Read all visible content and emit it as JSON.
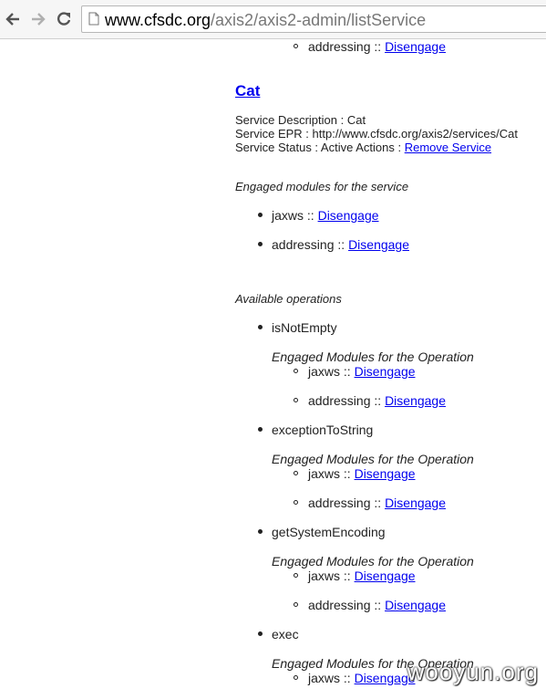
{
  "browser": {
    "url_domain": "www.cfsdc.org",
    "url_path": "/axis2/axis2-admin/listService"
  },
  "prev_item": {
    "name": "addressing",
    "sep": " :: ",
    "link": "Disengage"
  },
  "service": {
    "title": "Cat",
    "description": "Service Description : Cat",
    "epr": "Service EPR : http://www.cfsdc.org/axis2/services/Cat",
    "status": "Service Status : Active Actions : ",
    "remove_link": "Remove Service",
    "engaged_heading": "Engaged modules for the service",
    "modules": [
      {
        "name": "jaxws",
        "sep": " :: ",
        "link": "Disengage"
      },
      {
        "name": "addressing",
        "sep": " :: ",
        "link": "Disengage"
      }
    ],
    "ops_heading": "Available operations",
    "op_modules_heading": "Engaged Modules for the Operation",
    "operations": [
      {
        "name": "isNotEmpty",
        "modules": [
          {
            "name": "jaxws",
            "link": "Disengage"
          },
          {
            "name": "addressing",
            "link": "Disengage"
          }
        ]
      },
      {
        "name": "exceptionToString",
        "modules": [
          {
            "name": "jaxws",
            "link": "Disengage"
          },
          {
            "name": "addressing",
            "link": "Disengage"
          }
        ]
      },
      {
        "name": "getSystemEncoding",
        "modules": [
          {
            "name": "jaxws",
            "link": "Disengage"
          },
          {
            "name": "addressing",
            "link": "Disengage"
          }
        ]
      },
      {
        "name": "exec",
        "modules": [
          {
            "name": "jaxws",
            "link": "Disengage"
          }
        ]
      }
    ]
  },
  "watermark": "wooyun.org"
}
